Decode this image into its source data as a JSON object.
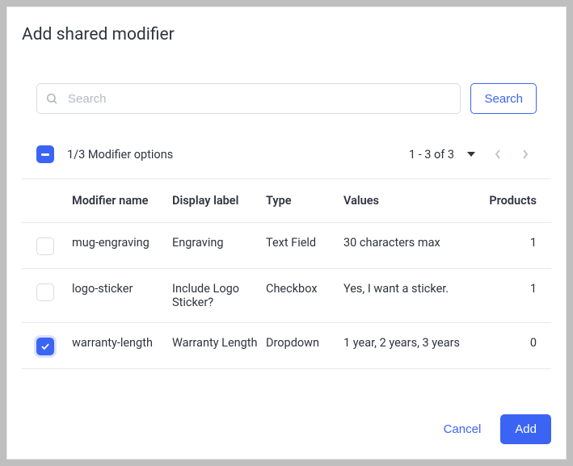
{
  "title": "Add shared modifier",
  "search": {
    "placeholder": "Search",
    "button": "Search"
  },
  "toolbar": {
    "selection_text": "1/3 Modifier options",
    "pager_text": "1 - 3 of 3"
  },
  "columns": {
    "name": "Modifier name",
    "label": "Display label",
    "type": "Type",
    "values": "Values",
    "products": "Products"
  },
  "rows": [
    {
      "checked": false,
      "name": "mug-engraving",
      "label": "Engraving",
      "type": "Text Field",
      "values": "30 characters max",
      "products": "1"
    },
    {
      "checked": false,
      "name": "logo-sticker",
      "label": "Include Logo Sticker?",
      "type": "Checkbox",
      "values": "Yes, I want a sticker.",
      "products": "1"
    },
    {
      "checked": true,
      "name": "warranty-length",
      "label": "Warranty Length",
      "type": "Dropdown",
      "values": "1 year, 2 years, 3 years",
      "products": "0"
    }
  ],
  "footer": {
    "cancel": "Cancel",
    "add": "Add"
  }
}
